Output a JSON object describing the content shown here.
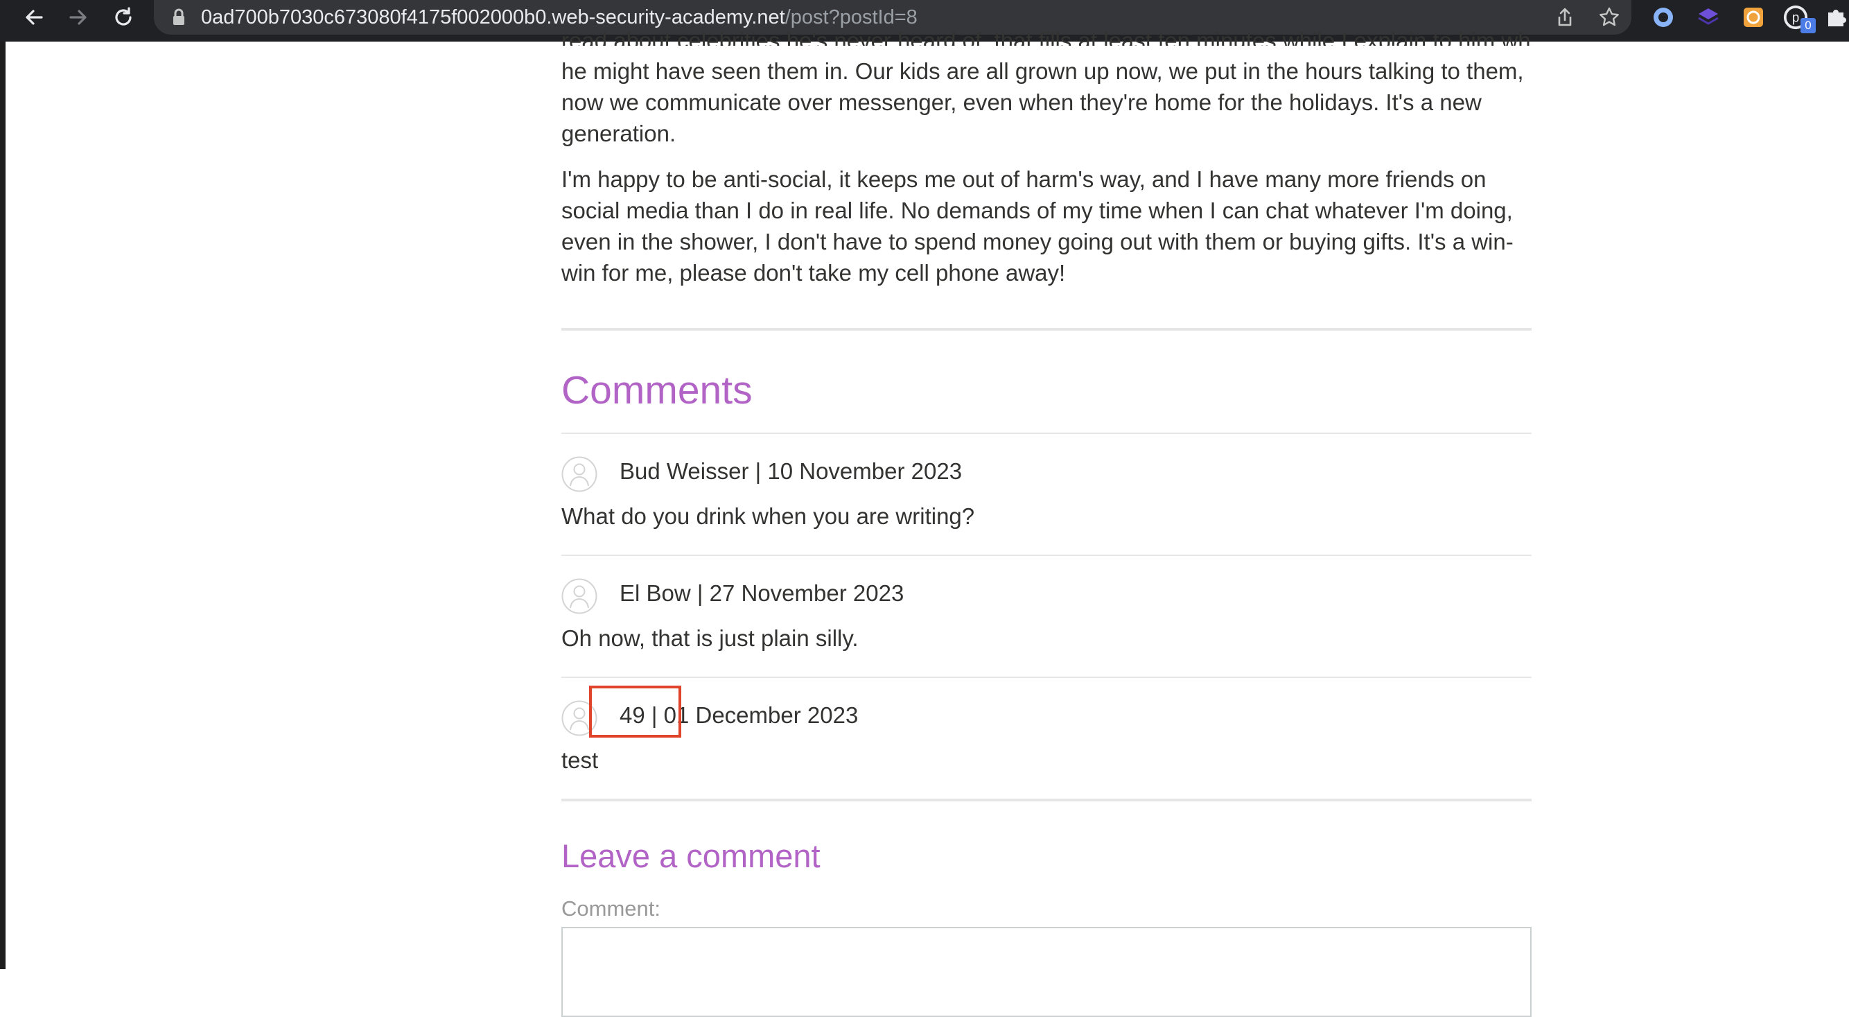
{
  "browser": {
    "url_host": "0ad700b7030c673080f4175f002000b0.web-security-academy.net",
    "url_path": "/post?postId=8",
    "extension_badge": "0"
  },
  "post": {
    "paragraph_partial_top": "read about celebrities he's never heard of, that fills at least ten minutes while I explain to him what",
    "paragraph_1": "he might have seen them in. Our kids are all grown up now, we put in the hours talking to them, now we communicate over messenger, even when they're home for the holidays. It's a new generation.",
    "paragraph_2": "I'm happy to be anti-social, it keeps me out of harm's way, and I have many more friends on social media than I do in real life. No demands of my time when I can chat whatever I'm doing, even in the shower, I don't have to spend money going out with them or buying gifts. It's a win-win for me, please don't take my cell phone away!"
  },
  "comments": {
    "title": "Comments",
    "items": [
      {
        "meta": "Bud Weisser | 10 November 2023",
        "body": "What do you drink when you are writing?"
      },
      {
        "meta": "El Bow | 27 November 2023",
        "body": "Oh now, that is just plain silly."
      },
      {
        "meta": "49 | 01 December 2023",
        "body": "test"
      }
    ]
  },
  "leave_comment": {
    "title": "Leave a comment",
    "comment_label": "Comment:"
  },
  "colors": {
    "accent": "#b164c5",
    "highlight_box": "#e0442b",
    "chrome": "#202124"
  }
}
